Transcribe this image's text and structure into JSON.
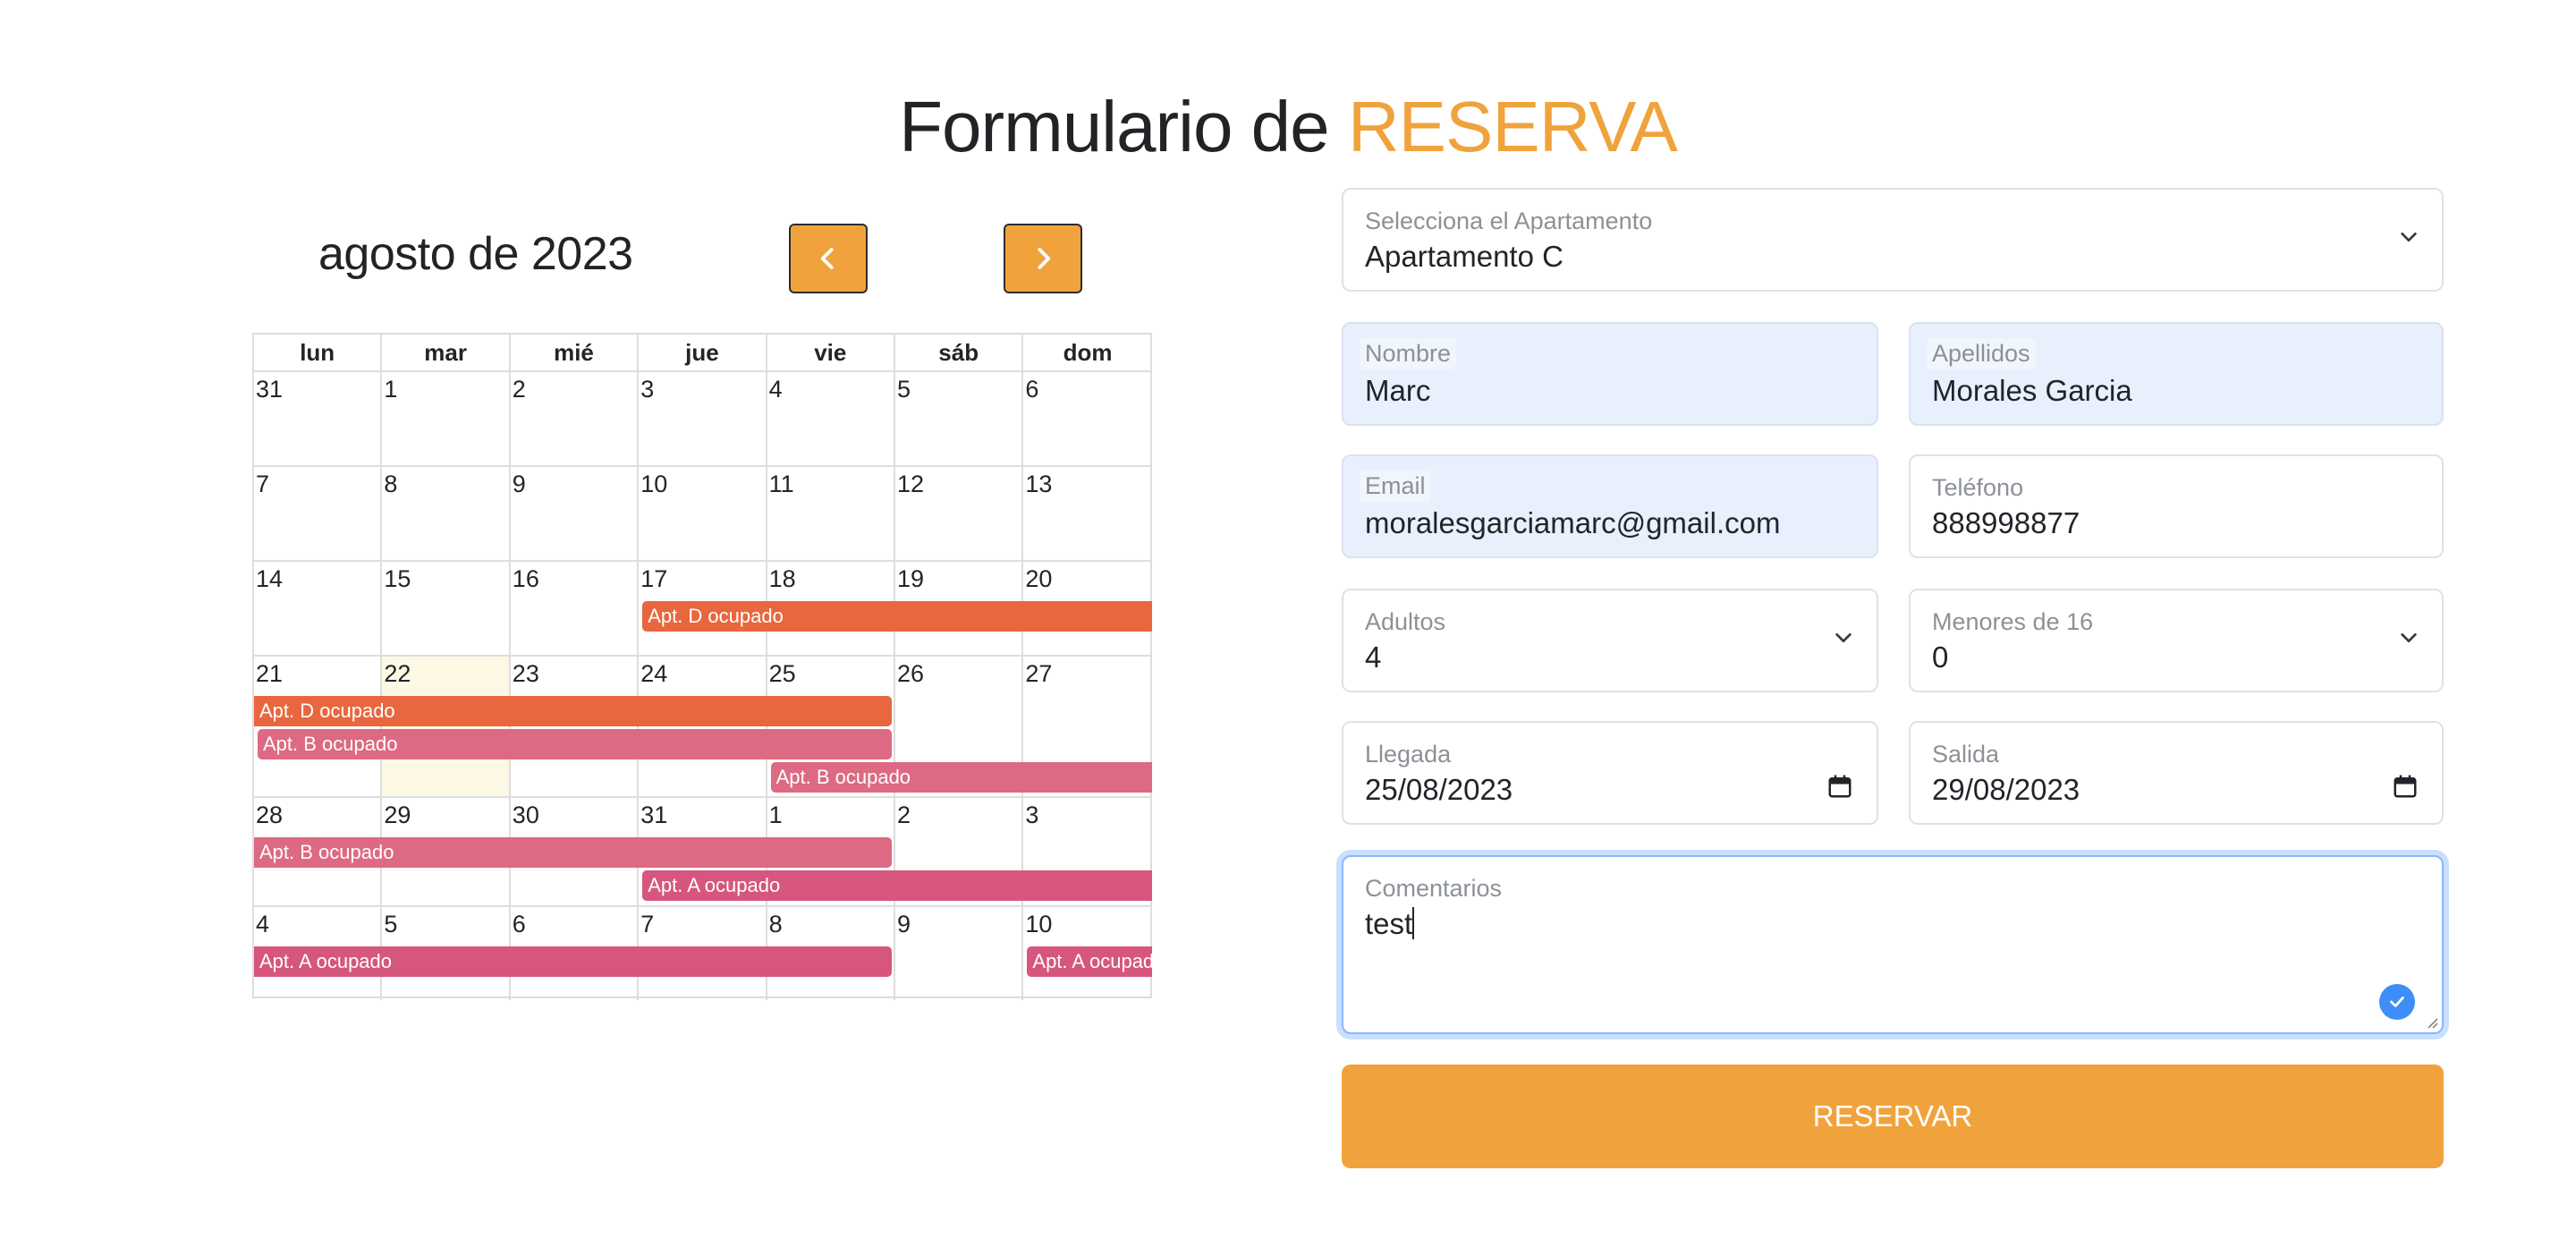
{
  "title": {
    "prefix": "Formulario de",
    "accent": "RESERVA"
  },
  "calendar": {
    "month_title": "agosto de 2023",
    "weekdays": [
      "lun",
      "mar",
      "mié",
      "jue",
      "vie",
      "sáb",
      "dom"
    ],
    "weeks": [
      {
        "days": [
          "31",
          "1",
          "2",
          "3",
          "4",
          "5",
          "6"
        ]
      },
      {
        "days": [
          "7",
          "8",
          "9",
          "10",
          "11",
          "12",
          "13"
        ]
      },
      {
        "days": [
          "14",
          "15",
          "16",
          "17",
          "18",
          "19",
          "20"
        ]
      },
      {
        "days": [
          "21",
          "22",
          "23",
          "24",
          "25",
          "26",
          "27"
        ]
      },
      {
        "days": [
          "28",
          "29",
          "30",
          "31",
          "1",
          "2",
          "3"
        ]
      },
      {
        "days": [
          "4",
          "5",
          "6",
          "7",
          "8",
          "9",
          "10"
        ]
      }
    ],
    "today": {
      "week": 3,
      "day": 1
    },
    "events": [
      {
        "label": "Apt. D ocupado",
        "kind": "d",
        "week": 2,
        "lane": 0,
        "start": 3,
        "end": 7,
        "open_left": false
      },
      {
        "label": "Apt. D ocupado",
        "kind": "d",
        "week": 3,
        "lane": 0,
        "start": 0,
        "end": 5,
        "open_left": true
      },
      {
        "label": "Apt. B ocupado",
        "kind": "b",
        "week": 3,
        "lane": 1,
        "start": 0,
        "end": 5,
        "open_left": false
      },
      {
        "label": "Apt. B ocupado",
        "kind": "b",
        "week": 3,
        "lane": 2,
        "start": 4,
        "end": 7,
        "open_left": false
      },
      {
        "label": "Apt. B ocupado",
        "kind": "b",
        "week": 4,
        "lane": 0,
        "start": 0,
        "end": 5,
        "open_left": true
      },
      {
        "label": "Apt. A ocupado",
        "kind": "a",
        "week": 4,
        "lane": 1,
        "start": 3,
        "end": 7,
        "open_left": false
      },
      {
        "label": "Apt. A ocupado",
        "kind": "a",
        "week": 5,
        "lane": 0,
        "start": 0,
        "end": 5,
        "open_left": true
      },
      {
        "label": "Apt. A ocupado",
        "kind": "a",
        "week": 5,
        "lane": 0,
        "start": 6,
        "end": 7,
        "open_left": false
      }
    ],
    "colors": {
      "d": "#e8673f",
      "b": "#dd6a82",
      "a": "#d6567e",
      "today_bg": "#fcf8e3"
    }
  },
  "form": {
    "apartment": {
      "label": "Selecciona el Apartamento",
      "value": "Apartamento C"
    },
    "nombre": {
      "label": "Nombre",
      "value": "Marc"
    },
    "apellidos": {
      "label": "Apellidos",
      "value": "Morales Garcia"
    },
    "email": {
      "label": "Email",
      "value": "moralesgarciamarc@gmail.com"
    },
    "telefono": {
      "label": "Teléfono",
      "value": "888998877"
    },
    "adultos": {
      "label": "Adultos",
      "value": "4"
    },
    "menores": {
      "label": "Menores de 16",
      "value": "0"
    },
    "llegada": {
      "label": "Llegada",
      "value": "25/08/2023"
    },
    "salida": {
      "label": "Salida",
      "value": "29/08/2023"
    },
    "comentarios": {
      "label": "Comentarios",
      "value": "test"
    },
    "submit_label": "RESERVAR"
  },
  "accent_color": "#f0a33c"
}
